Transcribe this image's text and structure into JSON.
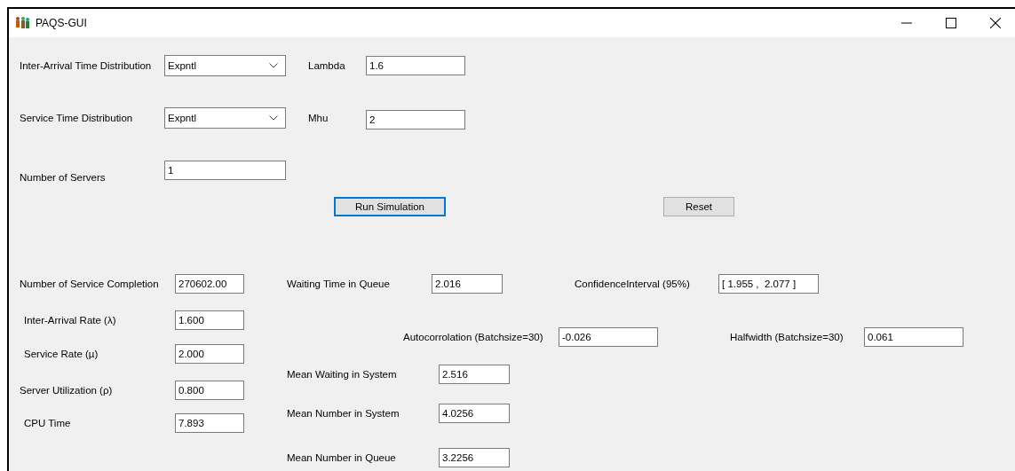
{
  "window": {
    "title": "PAQS-GUI"
  },
  "distributions": [
    {
      "label": "Inter-Arrival Time Distribution",
      "value": "Expntl",
      "param_label": "Lambda",
      "param_value": "1.6"
    },
    {
      "label": "Service Time Distribution",
      "value": "Expntl",
      "param_label": "Mhu",
      "param_value": "2"
    }
  ],
  "servers": {
    "label": "Number of Servers",
    "value": "1"
  },
  "buttons": [
    {
      "label": "Run Simulation",
      "focused": true
    },
    {
      "label": "Reset",
      "focused": false
    }
  ],
  "summary": [
    {
      "label": "Number of Service Completion",
      "value": "270602.00"
    },
    {
      "label": "Inter-Arrival Rate (λ)",
      "value": "1.600"
    },
    {
      "label": "Service Rate (µ)",
      "value": "2.000"
    },
    {
      "label": "Server Utilization (ρ)",
      "value": "0.800"
    },
    {
      "label": "CPU Time",
      "value": "7.893"
    }
  ],
  "queue_row": [
    {
      "label": "Waiting Time in Queue",
      "value": "2.016"
    },
    {
      "label": "ConfidenceInterval (95%)",
      "value": "[ 1.955 ,  2.077 ]"
    }
  ],
  "batch_row": [
    {
      "label": "Autocorrolation (Batchsize=30)",
      "value": "-0.026"
    },
    {
      "label": "Halfwidth (Batchsize=30)",
      "value": "0.061"
    }
  ],
  "means": [
    {
      "label": "Mean Waiting in System",
      "value": "2.516"
    },
    {
      "label": "Mean Number in System",
      "value": "4.0256"
    },
    {
      "label": "Mean Number in Queue",
      "value": "3.2256"
    }
  ]
}
